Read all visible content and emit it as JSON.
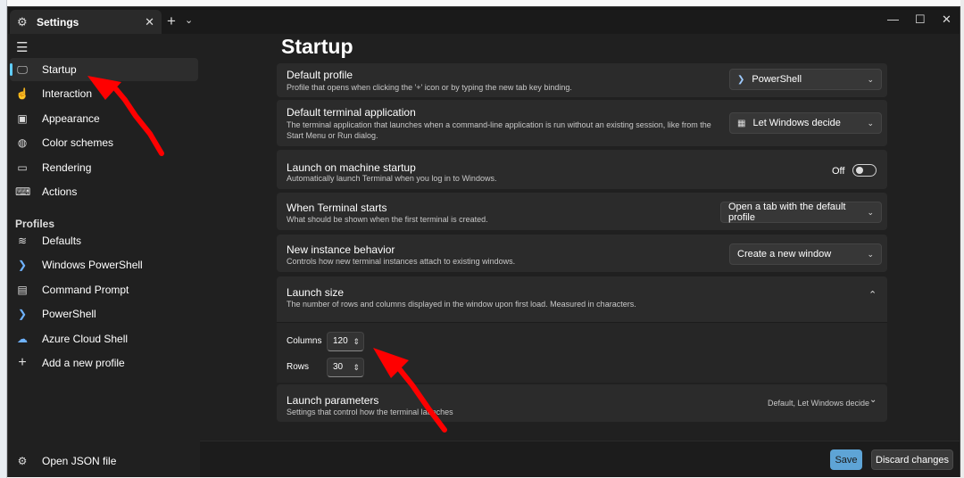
{
  "window": {
    "tab_title": "Settings",
    "tab_icon": "gear-icon",
    "new_tab": "+",
    "minimize": "—",
    "maximize": "☐",
    "close": "✕"
  },
  "sidebar": {
    "items": [
      {
        "label": "Startup",
        "icon": "startup-icon",
        "selected": true
      },
      {
        "label": "Interaction",
        "icon": "interaction-icon"
      },
      {
        "label": "Appearance",
        "icon": "appearance-icon"
      },
      {
        "label": "Color schemes",
        "icon": "palette-icon"
      },
      {
        "label": "Rendering",
        "icon": "monitor-icon"
      },
      {
        "label": "Actions",
        "icon": "keyboard-icon"
      }
    ],
    "profiles_header": "Profiles",
    "profiles": [
      {
        "label": "Defaults",
        "icon": "layers-icon"
      },
      {
        "label": "Windows PowerShell",
        "icon": "powershell-icon"
      },
      {
        "label": "Command Prompt",
        "icon": "cmd-icon"
      },
      {
        "label": "PowerShell",
        "icon": "powershell-icon"
      },
      {
        "label": "Azure Cloud Shell",
        "icon": "azure-icon"
      },
      {
        "label": "Add a new profile",
        "icon": "plus-icon"
      }
    ],
    "open_json": "Open JSON file"
  },
  "main": {
    "title": "Startup",
    "settings": {
      "default_profile": {
        "title": "Default profile",
        "desc": "Profile that opens when clicking the '+' icon or by typing the new tab key binding.",
        "value": "PowerShell"
      },
      "default_terminal": {
        "title": "Default terminal application",
        "desc": "The terminal application that launches when a command-line application is run without an existing session, like from the Start Menu or Run dialog.",
        "value": "Let Windows decide"
      },
      "launch_startup": {
        "title": "Launch on machine startup",
        "desc": "Automatically launch Terminal when you log in to Windows.",
        "value": "Off"
      },
      "when_starts": {
        "title": "When Terminal starts",
        "desc": "What should be shown when the first terminal is created.",
        "value": "Open a tab with the default profile"
      },
      "new_instance": {
        "title": "New instance behavior",
        "desc": "Controls how new terminal instances attach to existing windows.",
        "value": "Create a new window"
      },
      "launch_size": {
        "title": "Launch size",
        "desc": "The number of rows and columns displayed in the window upon first load. Measured in characters.",
        "columns_label": "Columns",
        "columns": "120",
        "rows_label": "Rows",
        "rows": "30"
      },
      "launch_params": {
        "title": "Launch parameters",
        "desc": "Settings that control how the terminal launches",
        "value": "Default, Let Windows decide"
      }
    }
  },
  "footer": {
    "save": "Save",
    "discard": "Discard changes"
  },
  "colors": {
    "accent": "#60cdff",
    "save_button": "#5ea4d6",
    "annotation": "#ff0000"
  }
}
